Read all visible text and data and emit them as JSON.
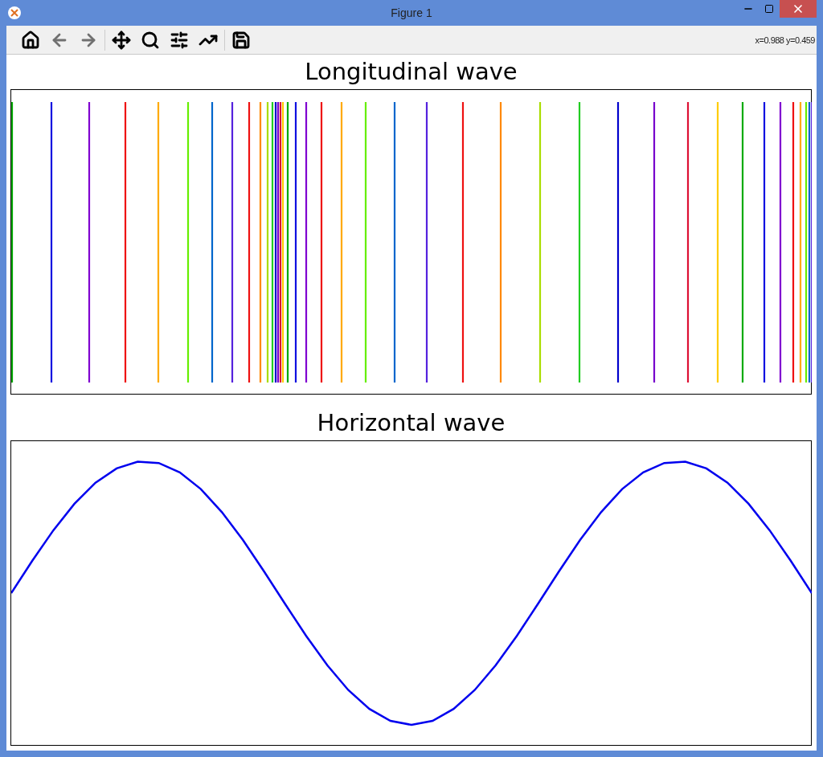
{
  "window": {
    "title": "Figure 1"
  },
  "toolbar": [
    {
      "kind": "home",
      "disabled": false
    },
    {
      "kind": "back",
      "disabled": true
    },
    {
      "kind": "forward",
      "disabled": true
    },
    {
      "kind": "separator"
    },
    {
      "kind": "pan",
      "disabled": false
    },
    {
      "kind": "zoom",
      "disabled": false
    },
    {
      "kind": "subplots",
      "disabled": false
    },
    {
      "kind": "customize",
      "disabled": false
    },
    {
      "kind": "separator"
    },
    {
      "kind": "save",
      "disabled": false
    }
  ],
  "coordinates": "x=0.988 y=0.459",
  "axes": [
    {
      "kind": "longitudinal",
      "title": "Longitudinal wave"
    },
    {
      "kind": "sine",
      "title": "Horizontal wave"
    }
  ]
}
